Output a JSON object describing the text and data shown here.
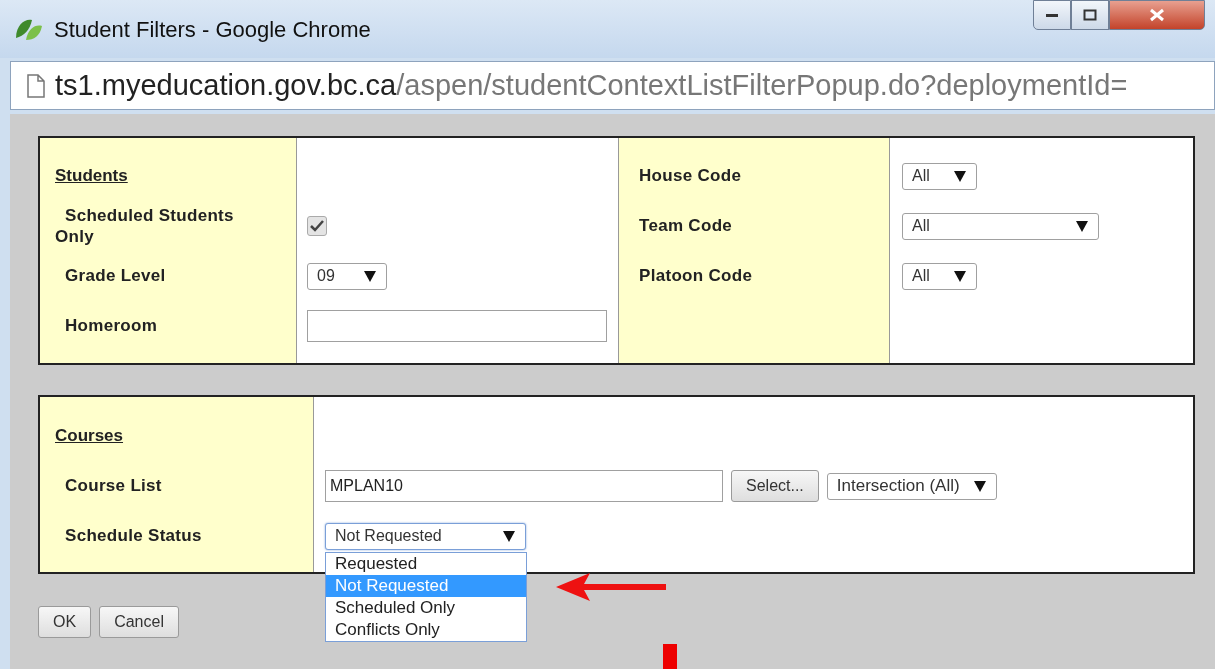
{
  "window": {
    "title": "Student Filters - Google Chrome"
  },
  "address": {
    "host": "ts1.myeducation.gov.bc.ca",
    "path": "/aspen/studentContextListFilterPopup.do?deploymentId="
  },
  "students": {
    "heading": "Students",
    "left_fields": [
      {
        "label": "Scheduled Students Only",
        "kind": "checkbox",
        "checked": true
      },
      {
        "label": "Grade Level",
        "kind": "select",
        "value": "09"
      },
      {
        "label": "Homeroom",
        "kind": "text"
      }
    ],
    "right_fields": [
      {
        "label": "House Code",
        "kind": "select",
        "value": "All"
      },
      {
        "label": "Team Code",
        "kind": "select",
        "value": "All",
        "wide": true
      },
      {
        "label": "Platoon Code",
        "kind": "select",
        "value": "All"
      }
    ]
  },
  "courses": {
    "heading": "Courses",
    "fields": [
      {
        "label": "Course List",
        "kind": "text",
        "value": "MPLAN10",
        "button": "Select...",
        "mode": "Intersection (All)"
      },
      {
        "label": "Schedule Status",
        "kind": "select",
        "value": "Not Requested",
        "expanded": true,
        "options": [
          {
            "label": "Requested",
            "selected": false
          },
          {
            "label": "Not Requested",
            "selected": true
          },
          {
            "label": "Scheduled Only",
            "selected": false
          },
          {
            "label": "Conflicts Only",
            "selected": false
          }
        ]
      }
    ]
  },
  "buttons": [
    "OK",
    "Cancel"
  ]
}
